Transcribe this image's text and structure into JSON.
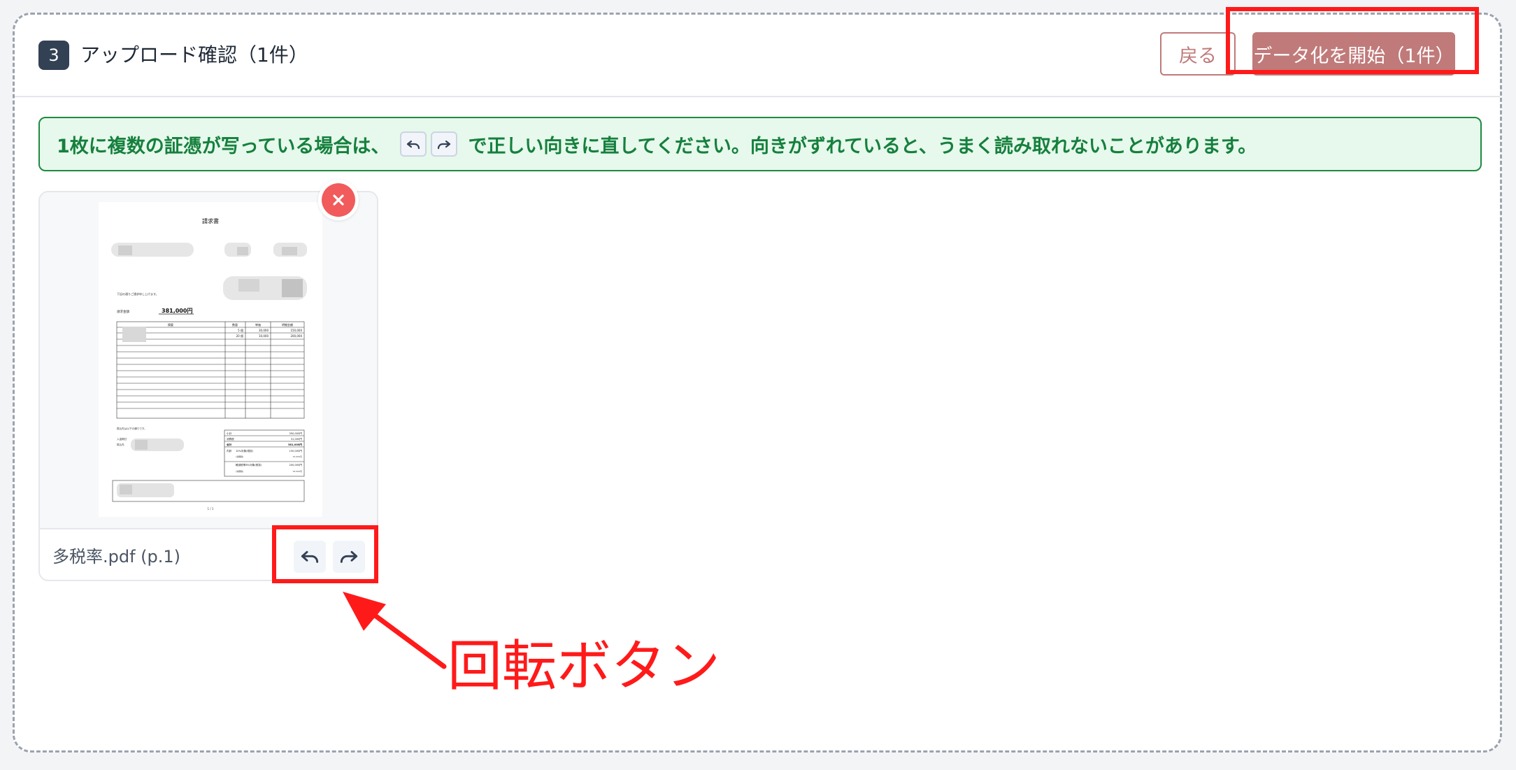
{
  "header": {
    "step_number": "3",
    "title": "アップロード確認（1件）",
    "back_label": "戻る",
    "start_label": "データ化を開始（1件）"
  },
  "notice": {
    "before": "1枚に複数の証憑が写っている場合は、",
    "after": "で正しい向きに直してください。向きがずれていると、うまく読み取れないことがあります。"
  },
  "file_card": {
    "file_name": "多税率.pdf (p.1)",
    "document": {
      "title": "請求書",
      "greeting": "下記の通りご請求申し上げます。",
      "amount_label": "請求金額",
      "amount": "381,000円",
      "table_headers": [
        "摘要",
        "数量",
        "単価",
        "明細金額"
      ],
      "rows": [
        [
          "5 個",
          "30,000",
          "150,000"
        ],
        [
          "20 個",
          "10,000",
          "200,000"
        ]
      ],
      "bank_note": "振込先は以下の通りです。",
      "bank_label": "入金期日",
      "bank_label2": "振込先",
      "summary": [
        [
          "小計",
          "350,000円"
        ],
        [
          "消費税",
          "31,000円"
        ],
        [
          "合計",
          "381,000円"
        ],
        [
          "内訳",
          "10%対象(税抜)",
          "150,000円"
        ],
        [
          "",
          "(消費税)",
          "15,000円"
        ],
        [
          "",
          "軽減税率8%対象(税抜)",
          "200,000円"
        ],
        [
          "",
          "(消費税)",
          "16,000円"
        ]
      ],
      "page_footer": "1 / 1"
    }
  },
  "annotation": {
    "label": "回転ボタン",
    "color": "#ff1a1a"
  },
  "colors": {
    "accent": "#c07a7a",
    "notice_green": "#15803d",
    "remove_red": "#f15b5b"
  },
  "icons": {
    "rotate_left": "rotate-left-icon",
    "rotate_right": "rotate-right-icon",
    "close": "close-icon"
  }
}
